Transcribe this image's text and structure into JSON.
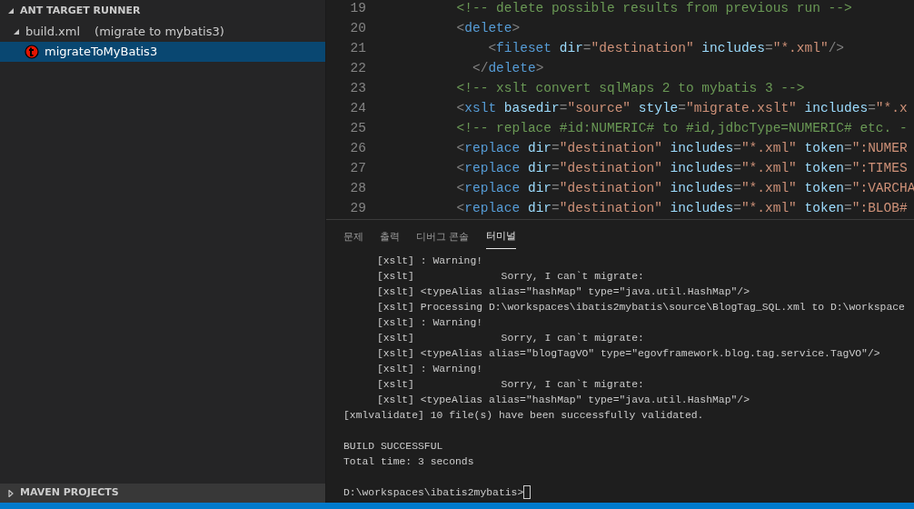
{
  "sidebar": {
    "sections": [
      {
        "title": "ANT TARGET RUNNER",
        "expanded": true,
        "items": [
          {
            "label": "build.xml",
            "detail": "(migrate to mybatis3)",
            "expanded": true,
            "selected": false,
            "children": [
              {
                "label": "migrateToMyBatis3",
                "selected": true
              }
            ]
          }
        ]
      },
      {
        "title": "MAVEN PROJECTS",
        "expanded": false
      }
    ]
  },
  "editor": {
    "lines": [
      {
        "number": "19",
        "kind": "body",
        "tokens": [
          {
            "kind": "comment",
            "text": "<!-- delete possible results from previous run -->"
          }
        ]
      },
      {
        "number": "20",
        "kind": "body",
        "tokens": [
          {
            "kind": "punct",
            "text": "<"
          },
          {
            "kind": "tag",
            "text": "delete"
          },
          {
            "kind": "punct",
            "text": ">"
          }
        ]
      },
      {
        "number": "21",
        "kind": "nested",
        "tokens": [
          {
            "kind": "punct",
            "text": "<"
          },
          {
            "kind": "tag",
            "text": "fileset"
          },
          {
            "kind": "attr",
            "text": " dir"
          },
          {
            "kind": "punct",
            "text": "="
          },
          {
            "kind": "string",
            "text": "\"destination\""
          },
          {
            "kind": "attr",
            "text": " includes"
          },
          {
            "kind": "punct",
            "text": "="
          },
          {
            "kind": "string",
            "text": "\"*.xml\""
          },
          {
            "kind": "punct",
            "text": "/>"
          }
        ]
      },
      {
        "number": "22",
        "kind": "closing",
        "tokens": [
          {
            "kind": "punct",
            "text": "</"
          },
          {
            "kind": "tag",
            "text": "delete"
          },
          {
            "kind": "punct",
            "text": ">"
          }
        ]
      },
      {
        "number": "23",
        "kind": "body",
        "tokens": [
          {
            "kind": "comment",
            "text": "<!-- xslt convert sqlMaps 2 to mybatis 3 -->"
          }
        ]
      },
      {
        "number": "24",
        "kind": "body",
        "tokens": [
          {
            "kind": "punct",
            "text": "<"
          },
          {
            "kind": "tag",
            "text": "xslt"
          },
          {
            "kind": "attr",
            "text": " basedir"
          },
          {
            "kind": "punct",
            "text": "="
          },
          {
            "kind": "string",
            "text": "\"source\""
          },
          {
            "kind": "attr",
            "text": " style"
          },
          {
            "kind": "punct",
            "text": "="
          },
          {
            "kind": "string",
            "text": "\"migrate.xslt\""
          },
          {
            "kind": "attr",
            "text": " includes"
          },
          {
            "kind": "punct",
            "text": "="
          },
          {
            "kind": "string",
            "text": "\"*.x"
          }
        ]
      },
      {
        "number": "25",
        "kind": "body",
        "tokens": [
          {
            "kind": "comment",
            "text": "<!-- replace #id:NUMERIC# to #id,jdbcType=NUMERIC# etc. -"
          }
        ]
      },
      {
        "number": "26",
        "kind": "body",
        "tokens": [
          {
            "kind": "punct",
            "text": "<"
          },
          {
            "kind": "tag",
            "text": "replace"
          },
          {
            "kind": "attr",
            "text": " dir"
          },
          {
            "kind": "punct",
            "text": "="
          },
          {
            "kind": "string",
            "text": "\"destination\""
          },
          {
            "kind": "attr",
            "text": " includes"
          },
          {
            "kind": "punct",
            "text": "="
          },
          {
            "kind": "string",
            "text": "\"*.xml\""
          },
          {
            "kind": "attr",
            "text": " token"
          },
          {
            "kind": "punct",
            "text": "="
          },
          {
            "kind": "string",
            "text": "\":NUMER"
          }
        ]
      },
      {
        "number": "27",
        "kind": "body",
        "tokens": [
          {
            "kind": "punct",
            "text": "<"
          },
          {
            "kind": "tag",
            "text": "replace"
          },
          {
            "kind": "attr",
            "text": " dir"
          },
          {
            "kind": "punct",
            "text": "="
          },
          {
            "kind": "string",
            "text": "\"destination\""
          },
          {
            "kind": "attr",
            "text": " includes"
          },
          {
            "kind": "punct",
            "text": "="
          },
          {
            "kind": "string",
            "text": "\"*.xml\""
          },
          {
            "kind": "attr",
            "text": " token"
          },
          {
            "kind": "punct",
            "text": "="
          },
          {
            "kind": "string",
            "text": "\":TIMES"
          }
        ]
      },
      {
        "number": "28",
        "kind": "body",
        "tokens": [
          {
            "kind": "punct",
            "text": "<"
          },
          {
            "kind": "tag",
            "text": "replace"
          },
          {
            "kind": "attr",
            "text": " dir"
          },
          {
            "kind": "punct",
            "text": "="
          },
          {
            "kind": "string",
            "text": "\"destination\""
          },
          {
            "kind": "attr",
            "text": " includes"
          },
          {
            "kind": "punct",
            "text": "="
          },
          {
            "kind": "string",
            "text": "\"*.xml\""
          },
          {
            "kind": "attr",
            "text": " token"
          },
          {
            "kind": "punct",
            "text": "="
          },
          {
            "kind": "string",
            "text": "\":VARCHA"
          }
        ]
      },
      {
        "number": "29",
        "kind": "body",
        "tokens": [
          {
            "kind": "punct",
            "text": "<"
          },
          {
            "kind": "tag",
            "text": "replace"
          },
          {
            "kind": "attr",
            "text": " dir"
          },
          {
            "kind": "punct",
            "text": "="
          },
          {
            "kind": "string",
            "text": "\"destination\""
          },
          {
            "kind": "attr",
            "text": " includes"
          },
          {
            "kind": "punct",
            "text": "="
          },
          {
            "kind": "string",
            "text": "\"*.xml\""
          },
          {
            "kind": "attr",
            "text": " token"
          },
          {
            "kind": "punct",
            "text": "="
          },
          {
            "kind": "string",
            "text": "\":BLOB#"
          }
        ]
      }
    ]
  },
  "panel": {
    "tabs": [
      {
        "label": "문제",
        "selected": false
      },
      {
        "label": "출력",
        "selected": false
      },
      {
        "label": "디버그 콘솔",
        "selected": false
      },
      {
        "label": "터미널",
        "selected": true
      }
    ],
    "terminal_lines": [
      {
        "kind": "task",
        "text": "[xslt] : Warning!"
      },
      {
        "kind": "task",
        "text": "[xslt]              Sorry, I can`t migrate:"
      },
      {
        "kind": "task",
        "text": "[xslt] <typeAlias alias=\"hashMap\" type=\"java.util.HashMap\"/>"
      },
      {
        "kind": "task",
        "text": "[xslt] Processing D:\\workspaces\\ibatis2mybatis\\source\\BlogTag_SQL.xml to D:\\workspace"
      },
      {
        "kind": "task",
        "text": "[xslt] : Warning!"
      },
      {
        "kind": "task",
        "text": "[xslt]              Sorry, I can`t migrate:"
      },
      {
        "kind": "task",
        "text": "[xslt] <typeAlias alias=\"blogTagVO\" type=\"egovframework.blog.tag.service.TagVO\"/>"
      },
      {
        "kind": "task",
        "text": "[xslt] : Warning!"
      },
      {
        "kind": "task",
        "text": "[xslt]              Sorry, I can`t migrate:"
      },
      {
        "kind": "task",
        "text": "[xslt] <typeAlias alias=\"hashMap\" type=\"java.util.HashMap\"/>"
      },
      {
        "kind": "plain",
        "text": "[xmlvalidate] 10 file(s) have been successfully validated."
      },
      {
        "kind": "blank"
      },
      {
        "kind": "plain",
        "text": "BUILD SUCCESSFUL"
      },
      {
        "kind": "plain",
        "text": "Total time: 3 seconds"
      },
      {
        "kind": "blank"
      },
      {
        "kind": "prompt",
        "text": "D:\\workspaces\\ibatis2mybatis>"
      }
    ]
  }
}
